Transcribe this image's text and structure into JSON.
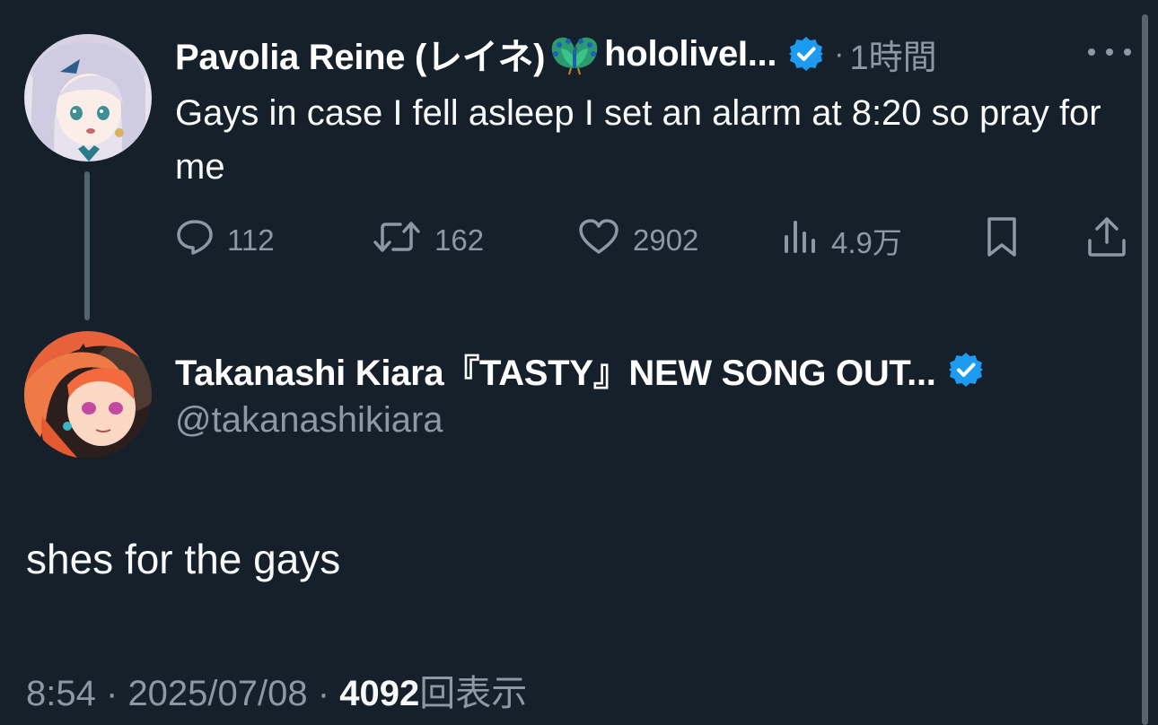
{
  "original_tweet": {
    "display_name": "Pavolia Reine (レイネ)",
    "display_name_suffix": "hololiveI...",
    "emoji": "peacock",
    "verified": true,
    "separator": "·",
    "time_ago": "1時間",
    "text": "Gays in case I fell asleep I set an alarm at 8:20 so pray for me",
    "actions": {
      "reply_count": "112",
      "retweet_count": "162",
      "like_count": "2902",
      "view_count": "4.9万"
    },
    "icons": [
      "reply-icon",
      "retweet-icon",
      "like-icon",
      "views-icon",
      "bookmark-icon",
      "share-icon",
      "more-icon",
      "verified-icon"
    ]
  },
  "reply_tweet": {
    "display_name": "Takanashi Kiara『TASTY』NEW SONG OUT...",
    "verified": true,
    "handle": "@takanashikiara",
    "text": "shes for the gays",
    "timestamp": "8:54",
    "date": "2025/07/08",
    "separator": "·",
    "views_count": "4092",
    "views_label": "回表示"
  },
  "colors": {
    "background": "#15202b",
    "text_primary": "#f7f9f9",
    "text_secondary": "#8b98a5",
    "verified_blue": "#1d9bf0",
    "thread_line": "#536370"
  }
}
